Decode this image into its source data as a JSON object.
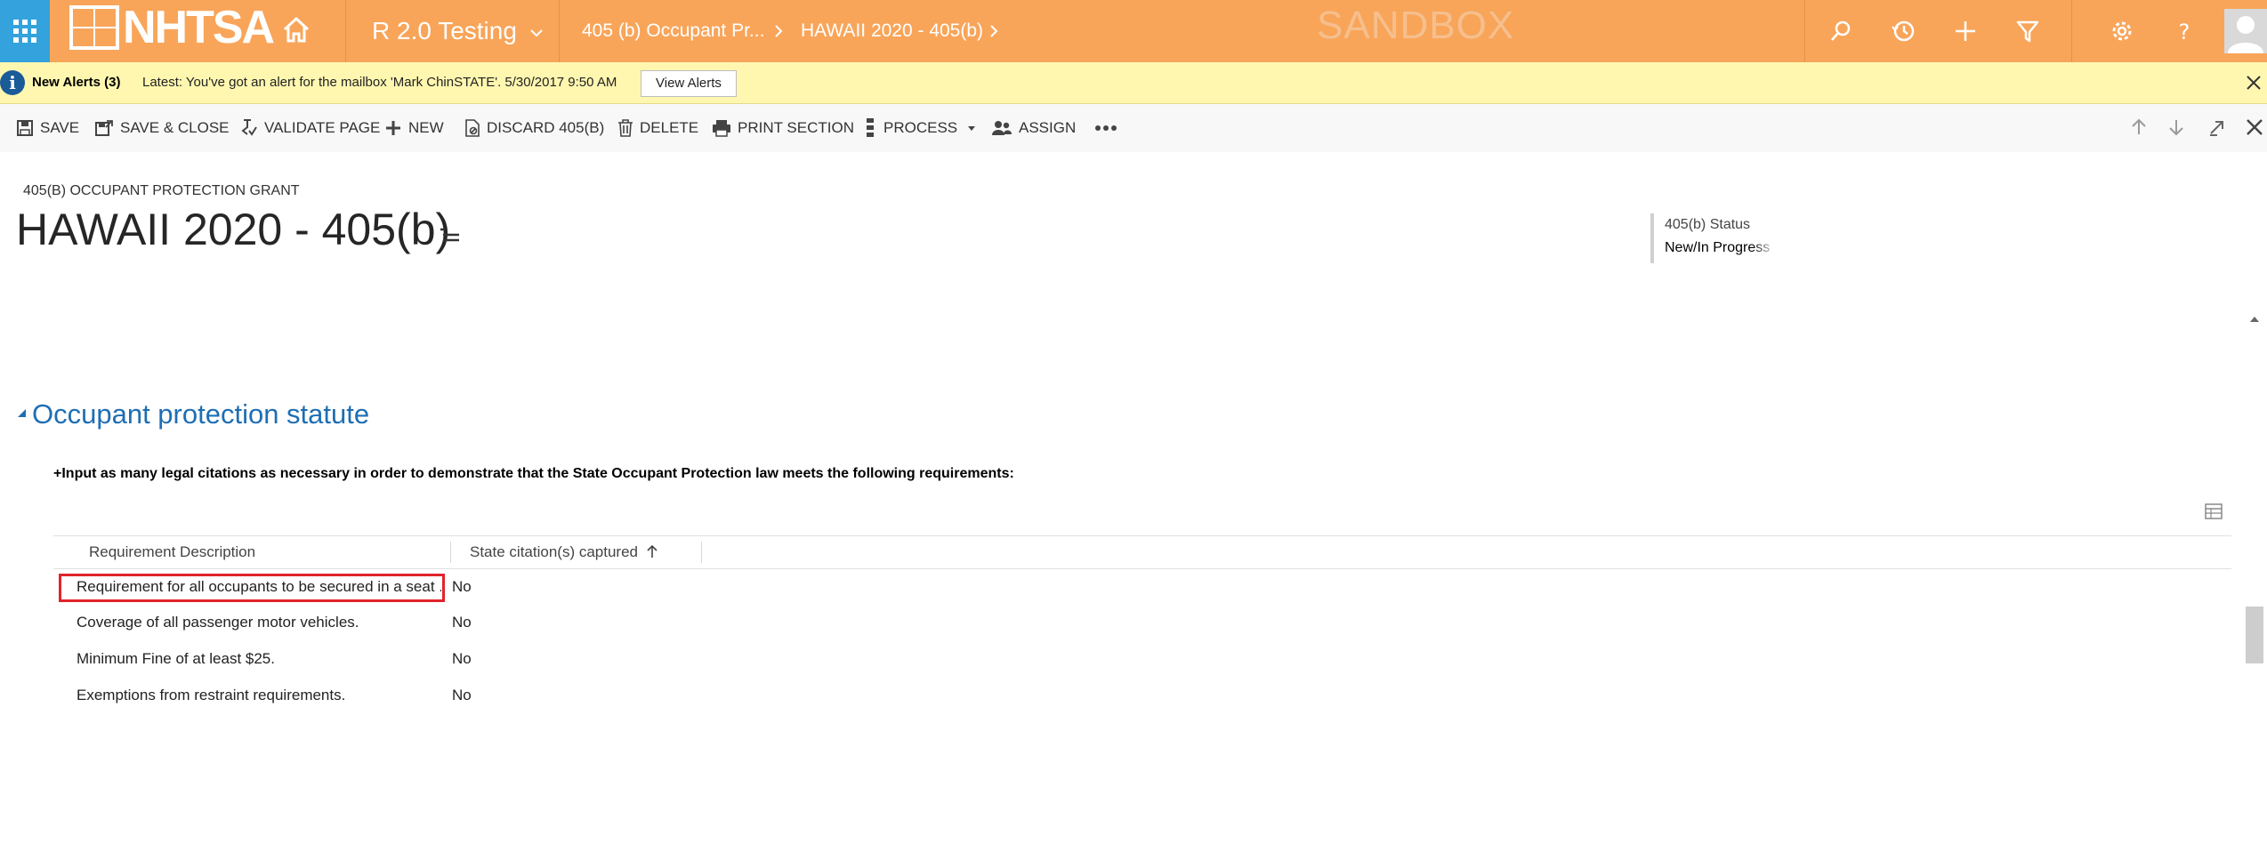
{
  "nav": {
    "logo_text": "NHTSA",
    "app_name": "R 2.0 Testing",
    "breadcrumbs": [
      "405 (b) Occupant Pr...",
      "HAWAII 2020 - 405(b)"
    ],
    "environment_label": "SANDBOX",
    "icons": [
      "apps-waffle-icon",
      "home-icon",
      "search-icon",
      "recent-history-icon",
      "create-plus-icon",
      "advanced-find-filter-icon",
      "settings-gear-icon",
      "help-icon",
      "user-avatar-icon"
    ],
    "accent_color": "#f8a55a",
    "waffle_color": "#34a2dc"
  },
  "alert": {
    "title": "New Alerts (3)",
    "message": "Latest: You've got an alert for the mailbox 'Mark ChinSTATE'. 5/30/2017 9:50 AM",
    "button_label": "View Alerts",
    "background_color": "#fff7b0"
  },
  "commands": {
    "save": "SAVE",
    "save_close": "SAVE & CLOSE",
    "validate": "VALIDATE PAGE",
    "new": "NEW",
    "discard": "DISCARD 405(B)",
    "delete": "DELETE",
    "print": "PRINT SECTION",
    "process": "PROCESS",
    "assign": "ASSIGN"
  },
  "record": {
    "entity_type": "405(B) OCCUPANT PROTECTION GRANT",
    "title": "HAWAII 2020 - 405(b)",
    "status_label": "405(b) Status",
    "status_value": "New/In Progress"
  },
  "section": {
    "title": "Occupant protection statute",
    "instructions": "+Input as many legal citations as necessary in order to demonstrate that the State Occupant Protection law meets the following requirements:",
    "title_color": "#1e6eb4"
  },
  "table": {
    "columns": [
      "Requirement Description",
      "State citation(s) captured"
    ],
    "sort_column": "State citation(s) captured",
    "sort_direction": "ascending",
    "rows": [
      {
        "description": "Requirement for all occupants to be secured in a seat ...",
        "captured": "No",
        "highlighted": true
      },
      {
        "description": "Coverage of all passenger motor vehicles.",
        "captured": "No",
        "highlighted": false
      },
      {
        "description": "Minimum Fine of at least $25.",
        "captured": "No",
        "highlighted": false
      },
      {
        "description": "Exemptions from restraint requirements.",
        "captured": "No",
        "highlighted": false
      }
    ],
    "highlight_color": "#e0242b"
  }
}
